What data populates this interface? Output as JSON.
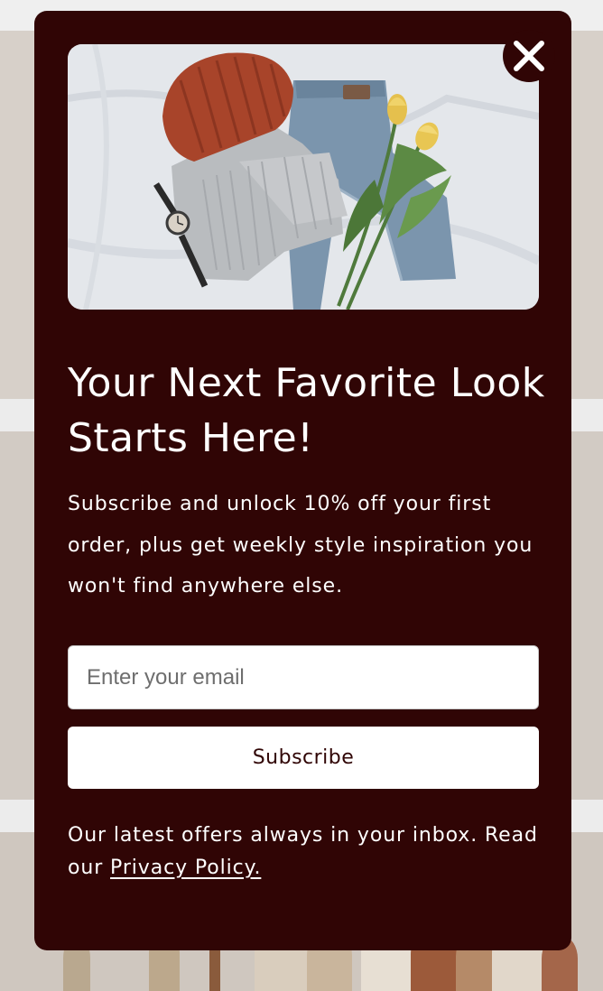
{
  "popup": {
    "headline": "Your Next Favorite Look Starts Here!",
    "subtext": "Subscribe and unlock 10% off your first order, plus get weekly style inspiration you won't find anywhere else.",
    "email_placeholder": "Enter your email",
    "email_value": "",
    "subscribe_label": "Subscribe",
    "footer_text": "Our latest offers always in your inbox. Read our ",
    "privacy_link_text": "Privacy Policy.",
    "close_icon": "close-icon",
    "hero_image": "flat-lay-outfit-photo"
  },
  "colors": {
    "popup_background": "#300505",
    "button_background": "#ffffff",
    "button_text": "#300505",
    "page_background": "#d7d0c9"
  }
}
